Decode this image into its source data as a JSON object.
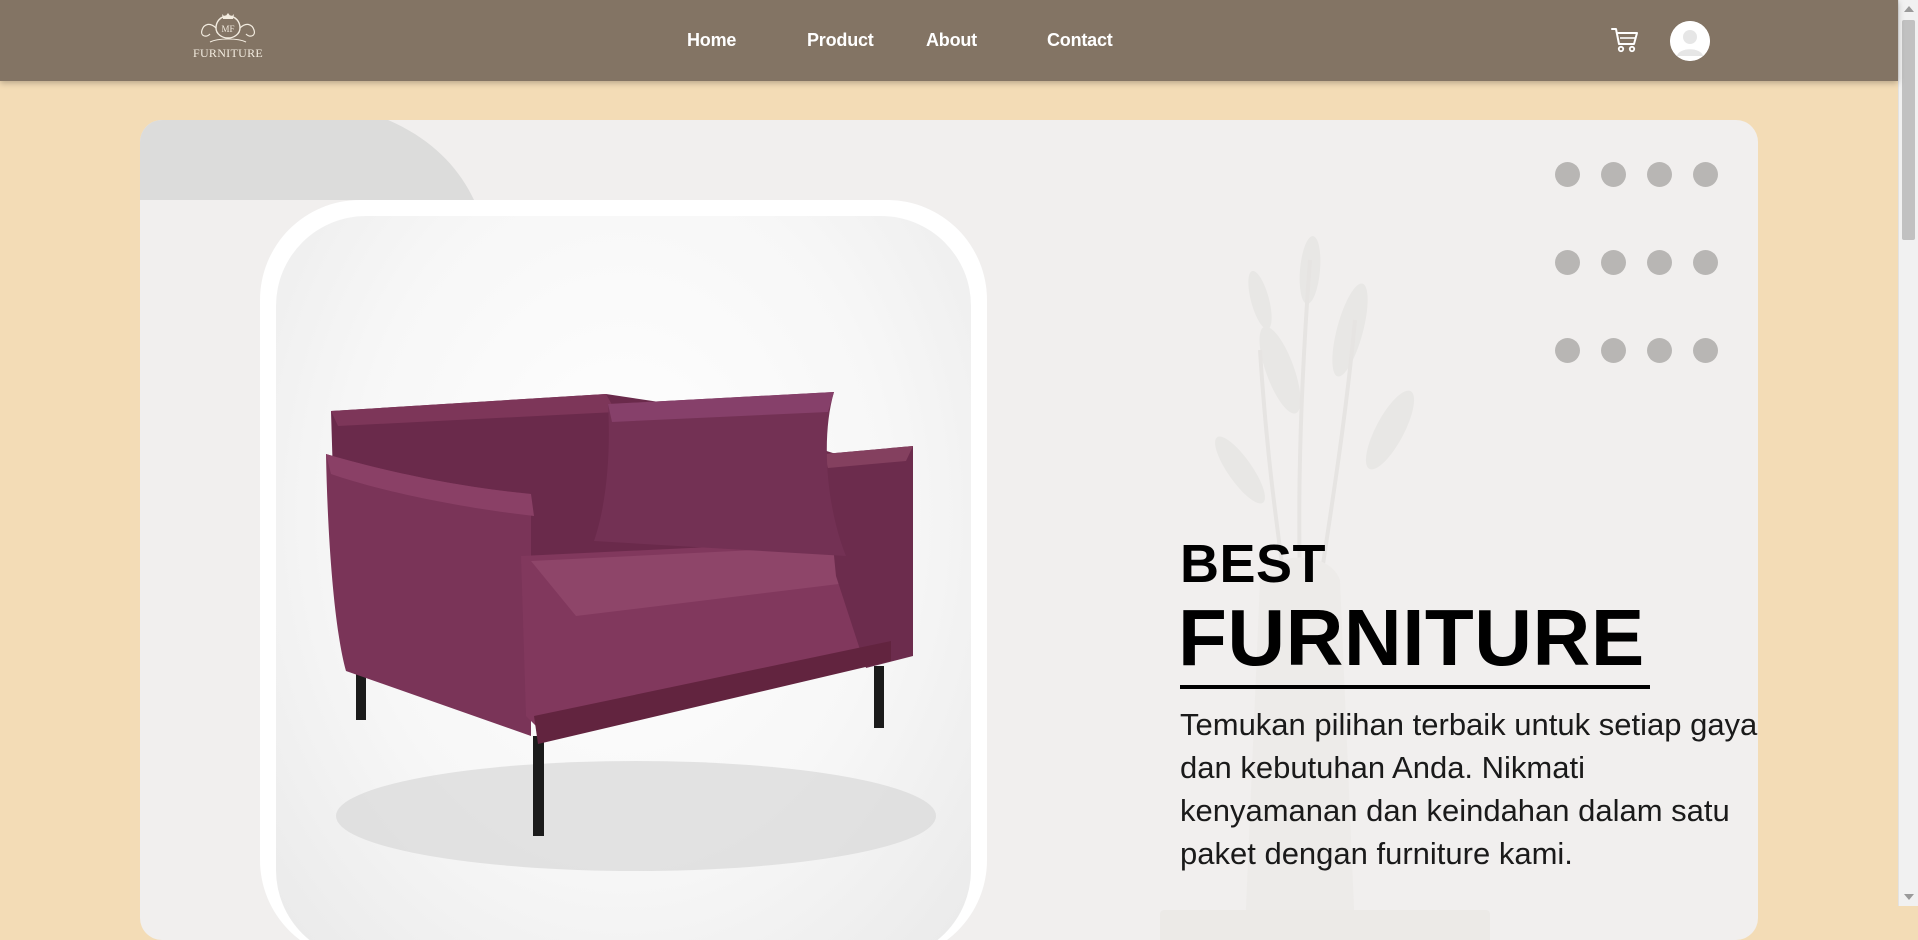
{
  "header": {
    "logo": {
      "text": "FURNITURE",
      "monogram": "MF",
      "icon": "ornamental-crest-icon"
    },
    "nav": [
      {
        "label": "Home"
      },
      {
        "label": "Product"
      },
      {
        "label": "About"
      },
      {
        "label": "Contact"
      }
    ],
    "cart_icon": "cart-icon",
    "avatar_icon": "user-avatar-icon"
  },
  "hero": {
    "title_line1": "BEST",
    "title_line2": "FURNITURE",
    "description": "Temukan pilihan terbaik untuk setiap gaya dan kebutuhan Anda. Nikmati kenyamanan dan keindahan dalam satu paket dengan furniture kami.",
    "product_image": "purple-loveseat-sofa",
    "background_image": "faded-vase-with-lilies"
  },
  "colors": {
    "page_background": "#f3dcb6",
    "header_background": "#837464",
    "hero_background": "#f1efee",
    "sofa": "#7a3458",
    "dots": "#b8b6b4",
    "text": "#000000"
  }
}
